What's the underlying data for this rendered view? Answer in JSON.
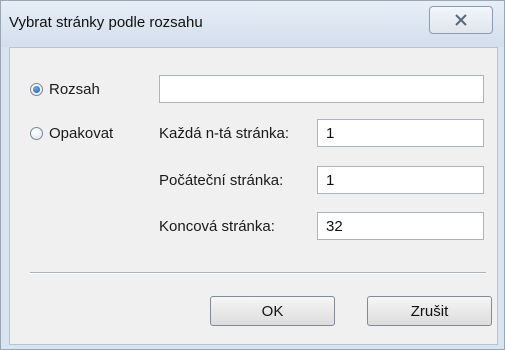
{
  "dialog": {
    "title": "Vybrat stránky podle rozsahu",
    "close_icon": "close-icon"
  },
  "mode": {
    "selected": "range",
    "range_label": "Rozsah",
    "repeat_label": "Opakovat"
  },
  "range": {
    "value": ""
  },
  "repeat": {
    "every_nth_label": "Každá n-tá stránka:",
    "every_nth_value": "1",
    "start_label": "Počáteční stránka:",
    "start_value": "1",
    "end_label": "Koncová stránka:",
    "end_value": "32"
  },
  "buttons": {
    "ok_label": "OK",
    "cancel_label": "Zrušit"
  }
}
